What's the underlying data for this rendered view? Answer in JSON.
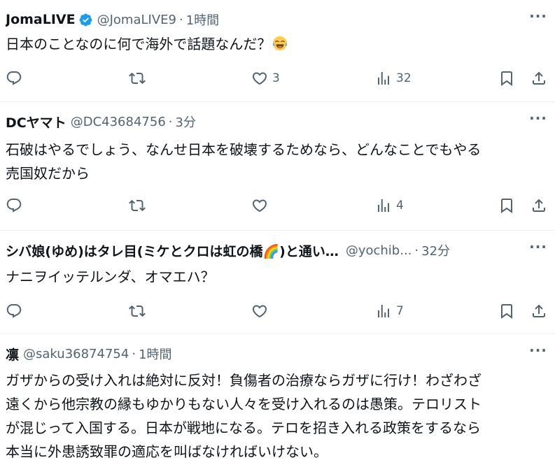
{
  "posts": [
    {
      "name": "JomaLIVE",
      "verified": true,
      "handle": "@JomaLIVE9",
      "dot": "·",
      "time": "1時間",
      "text": "日本のことなのに何で海外で話題なんだ？",
      "emoji": "face-with-tears-of-joy",
      "likes": "3",
      "views": "32"
    },
    {
      "name": "DCヤマト",
      "handle": "@DC43684756",
      "dot": "·",
      "time": "3分",
      "text_lines": [
        "石破はやるでしょう、なんせ日本を破壊するためなら、どんなことでもやる",
        "売国奴だから"
      ],
      "views": "4"
    },
    {
      "name": "シバ娘(ゆめ)はタレ目(ミケとクロは虹の橋🌈)と通い…",
      "handle": "@yochib...",
      "dot": "·",
      "time": "32分",
      "text": "ナニヲイッテルンダ、オマエハ？",
      "views": "7"
    },
    {
      "name": "凛",
      "handle": "@saku36874754",
      "dot": "·",
      "time": "1時間",
      "text_lines": [
        "ガザからの受け入れは絶対に反対！負傷者の治療ならガザに行け！わざわざ",
        "遠くから他宗教の縁もゆかりもない人々を受け入れるのは愚策。テロリスト",
        "が混じって入国する。日本が戦地になる。テロを招き入れる政策をするなら",
        "本当に外患誘致罪の適応を叫ばなければいけない。"
      ]
    }
  ],
  "colors": {
    "text": "#0f1419",
    "secondary": "#536471",
    "verified": "#1d9bf0",
    "divider": "#eff3f4"
  }
}
